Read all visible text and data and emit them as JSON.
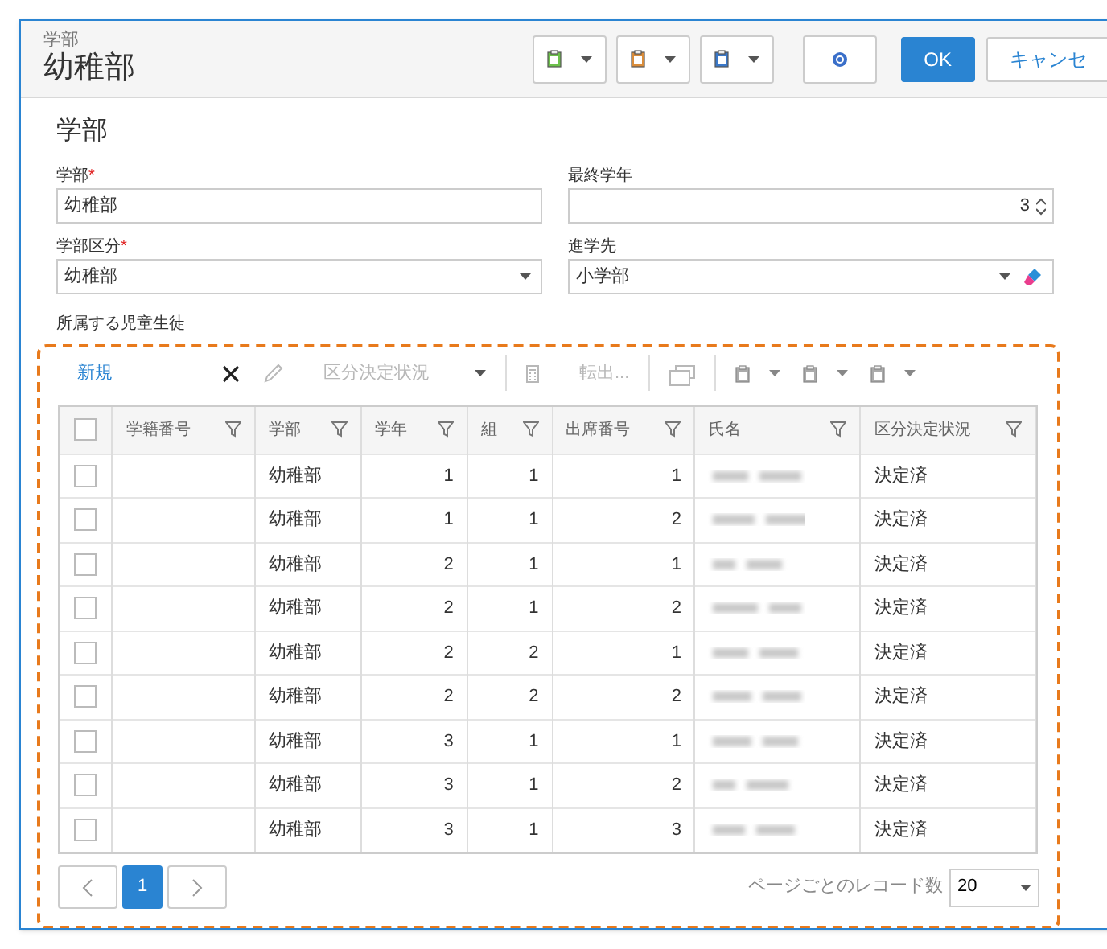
{
  "header": {
    "subtitle": "学部",
    "title": "幼稚部"
  },
  "header_buttons": [
    {
      "kind": "clipboard",
      "color": "#6cc04a"
    },
    {
      "kind": "clipboard",
      "color": "#d98c3a"
    },
    {
      "kind": "clipboard",
      "color": "#3a78c9"
    },
    {
      "kind": "help"
    }
  ],
  "ok_button": "OK",
  "cancel_button": "キャンセ",
  "section_title": "学部",
  "fields": [
    {
      "label": "学部",
      "required_mark": "*",
      "kind": "text",
      "value": "幼稚部"
    },
    {
      "label": "最終学年",
      "kind": "number",
      "value": "3"
    },
    {
      "label": "学部区分",
      "required_mark": "*",
      "kind": "select",
      "value": "幼稚部"
    },
    {
      "label": "進学先",
      "kind": "select_clear",
      "value": "小学部"
    }
  ],
  "select_all": {
    "checked": false
  },
  "grid_label": "所属する児童生徒",
  "grid_toolbar": [
    {
      "kind": "link",
      "label": "新規",
      "disabled": false
    },
    {
      "kind": "delete",
      "disabled": false
    },
    {
      "kind": "edit",
      "disabled": true
    },
    {
      "kind": "dropdown",
      "label": "区分決定状況",
      "disabled": true
    },
    {
      "kind": "calculator",
      "disabled": true
    },
    {
      "kind": "text",
      "label": "転出...",
      "disabled": true
    },
    {
      "kind": "window",
      "disabled": true
    },
    {
      "kind": "clipboard",
      "disabled": true
    },
    {
      "kind": "clipboard",
      "disabled": true
    },
    {
      "kind": "clipboard",
      "disabled": true
    }
  ],
  "columns": [
    "学籍番号",
    "学部",
    "学年",
    "組",
    "出席番号",
    "氏名",
    "区分決定状況"
  ],
  "rows": [
    {
      "checked": false,
      "dept": "幼稚部",
      "grade": "1",
      "class": "1",
      "number": "1",
      "status": "決定済"
    },
    {
      "checked": false,
      "dept": "幼稚部",
      "grade": "1",
      "class": "1",
      "number": "2",
      "status": "決定済"
    },
    {
      "checked": false,
      "dept": "幼稚部",
      "grade": "2",
      "class": "1",
      "number": "1",
      "status": "決定済"
    },
    {
      "checked": false,
      "dept": "幼稚部",
      "grade": "2",
      "class": "1",
      "number": "2",
      "status": "決定済"
    },
    {
      "checked": false,
      "dept": "幼稚部",
      "grade": "2",
      "class": "2",
      "number": "1",
      "status": "決定済"
    },
    {
      "checked": false,
      "dept": "幼稚部",
      "grade": "2",
      "class": "2",
      "number": "2",
      "status": "決定済"
    },
    {
      "checked": false,
      "dept": "幼稚部",
      "grade": "3",
      "class": "1",
      "number": "1",
      "status": "決定済"
    },
    {
      "checked": false,
      "dept": "幼稚部",
      "grade": "3",
      "class": "1",
      "number": "2",
      "status": "決定済"
    },
    {
      "checked": false,
      "dept": "幼稚部",
      "grade": "3",
      "class": "1",
      "number": "3",
      "status": "決定済"
    }
  ],
  "pagination": {
    "pages": [
      {
        "label": "1",
        "selected": true
      }
    ],
    "page_size_label": "ページごとのレコード数",
    "page_size": "20"
  }
}
